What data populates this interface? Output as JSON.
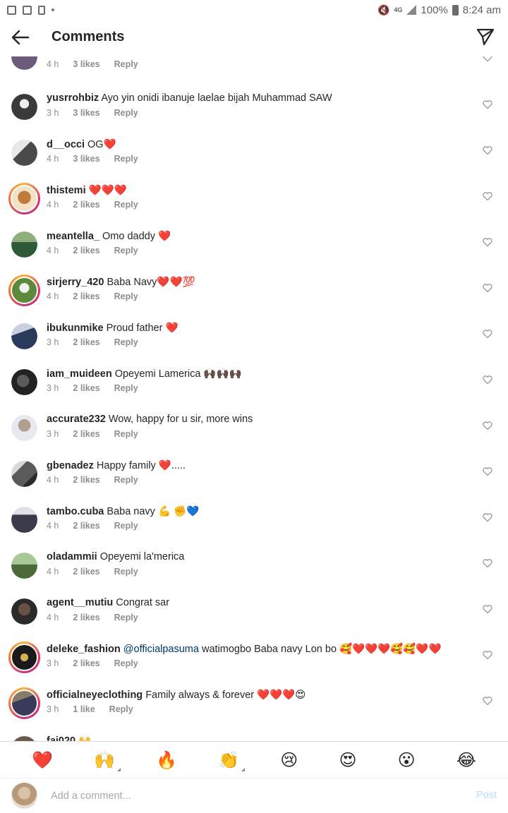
{
  "statusbar": {
    "battery": "100%",
    "time": "8:24 am",
    "network": "4G"
  },
  "header": {
    "title": "Comments"
  },
  "comments": [
    {
      "user": "",
      "text": "",
      "time": "4 h",
      "likes": "3 likes",
      "reply": "Reply",
      "avatar_color": "#6b5a7a"
    },
    {
      "user": "yusrrohbiz",
      "text": "Ayo yin onidi ibanuje laelae bijah Muhammad SAW",
      "time": "3 h",
      "likes": "3 likes",
      "reply": "Reply",
      "avatar_color": "#3a3a3a"
    },
    {
      "user": "d__occi",
      "text": "OG❤️",
      "time": "4 h",
      "likes": "3 likes",
      "reply": "Reply",
      "avatar_color": "#4a4a4a"
    },
    {
      "user": "thistemi",
      "text": "❤️❤️❤️",
      "time": "4 h",
      "likes": "2 likes",
      "reply": "Reply",
      "avatar_color": "#c07a3a"
    },
    {
      "user": "meantella_",
      "text": "Omo daddy ❤️",
      "time": "4 h",
      "likes": "2 likes",
      "reply": "Reply",
      "avatar_color": "#2f5a3a"
    },
    {
      "user": "sirjerry_420",
      "text": "Baba Navy❤️❤️💯",
      "time": "4 h",
      "likes": "2 likes",
      "reply": "Reply",
      "avatar_color": "#5d8a3a"
    },
    {
      "user": "ibukunmike",
      "text": "Proud father ❤️",
      "time": "3 h",
      "likes": "2 likes",
      "reply": "Reply",
      "avatar_color": "#2a3a5a"
    },
    {
      "user": "iam_muideen",
      "text": "Opeyemi Lamerica 🙌🏿🙌🏿🙌🏿",
      "time": "3 h",
      "likes": "2 likes",
      "reply": "Reply",
      "avatar_color": "#222222"
    },
    {
      "user": "accurate232",
      "text": "Wow, happy for u sir, more wins",
      "time": "3 h",
      "likes": "2 likes",
      "reply": "Reply",
      "avatar_color": "#b0a090"
    },
    {
      "user": "gbenadez",
      "text": "Happy family ❤️.....",
      "time": "4 h",
      "likes": "2 likes",
      "reply": "Reply",
      "avatar_color": "#5a5a5a"
    },
    {
      "user": "tambo.cuba",
      "text": "Baba navy 💪 ✊💙",
      "time": "4 h",
      "likes": "2 likes",
      "reply": "Reply",
      "avatar_color": "#3a3a4a"
    },
    {
      "user": "oladammii",
      "text": "Opeyemi la'merica",
      "time": "4 h",
      "likes": "2 likes",
      "reply": "Reply",
      "avatar_color": "#4a6a3a"
    },
    {
      "user": "agent__mutiu",
      "text": "Congrat sar",
      "time": "4 h",
      "likes": "2 likes",
      "reply": "Reply",
      "avatar_color": "#2a2a2a"
    },
    {
      "user": "deleke_fashion",
      "mention": "@officialpasuma",
      "text": " watimogbo Baba navy Lon bo 🥰❤️❤️❤️🥰🥰❤️❤️",
      "time": "3 h",
      "likes": "2 likes",
      "reply": "Reply",
      "avatar_color": "#1a1a1a"
    },
    {
      "user": "officialneyeclothing",
      "text": "Family always & forever ❤️❤️❤️😍",
      "time": "3 h",
      "likes": "1 like",
      "reply": "Reply",
      "avatar_color": "#3a3a5a"
    },
    {
      "user": "fai020",
      "text": "🙌",
      "time": "",
      "likes": "",
      "reply": "",
      "avatar_color": "#6a5a4a"
    }
  ],
  "emojis": [
    "❤️",
    "🙌",
    "🔥",
    "👏",
    "😢",
    "😍",
    "😮",
    "😂"
  ],
  "addbar": {
    "placeholder": "Add a comment...",
    "post": "Post"
  }
}
